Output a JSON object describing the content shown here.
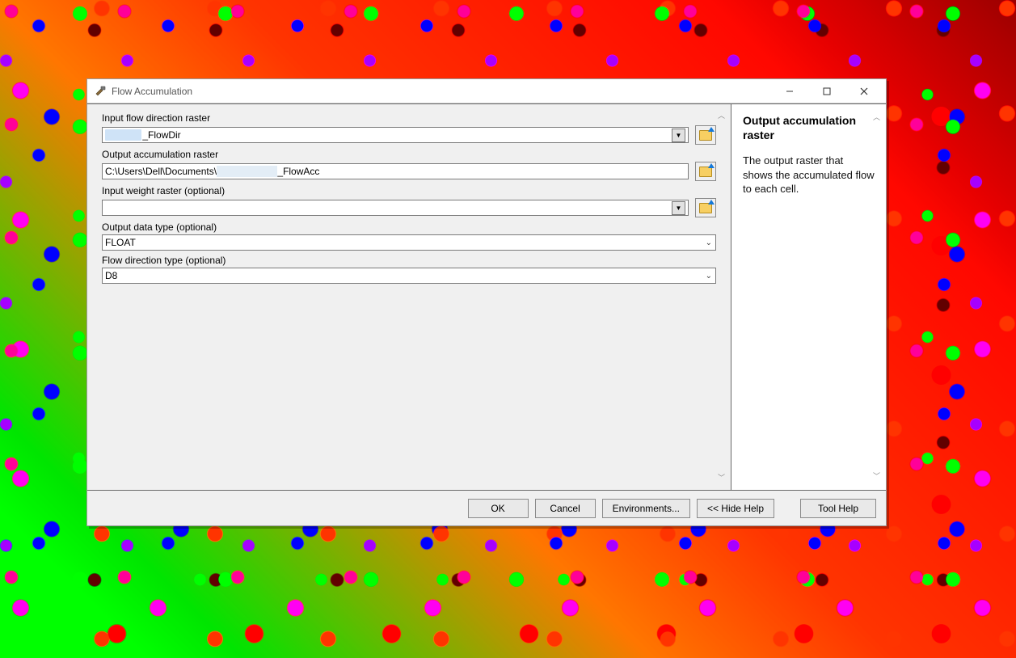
{
  "window": {
    "title": "Flow Accumulation",
    "minimize_tooltip": "Minimize",
    "maximize_tooltip": "Maximize",
    "close_tooltip": "Close"
  },
  "fields": {
    "input_flowdir": {
      "label": "Input flow direction raster",
      "value_suffix": "_FlowDir"
    },
    "output_accum": {
      "label": "Output accumulation raster",
      "value_prefix": "C:\\Users\\Dell\\Documents\\",
      "value_suffix": "_FlowAcc"
    },
    "input_weight": {
      "label": "Input weight raster (optional)",
      "value": ""
    },
    "output_type": {
      "label": "Output data type (optional)",
      "value": "FLOAT"
    },
    "flowdir_type": {
      "label": "Flow direction type (optional)",
      "value": "D8"
    }
  },
  "buttons": {
    "ok": "OK",
    "cancel": "Cancel",
    "environments": "Environments...",
    "hidehelp": "<< Hide Help",
    "toolhelp": "Tool Help"
  },
  "help": {
    "title": "Output accumulation raster",
    "body": "The output raster that shows the accumulated flow to each cell."
  }
}
